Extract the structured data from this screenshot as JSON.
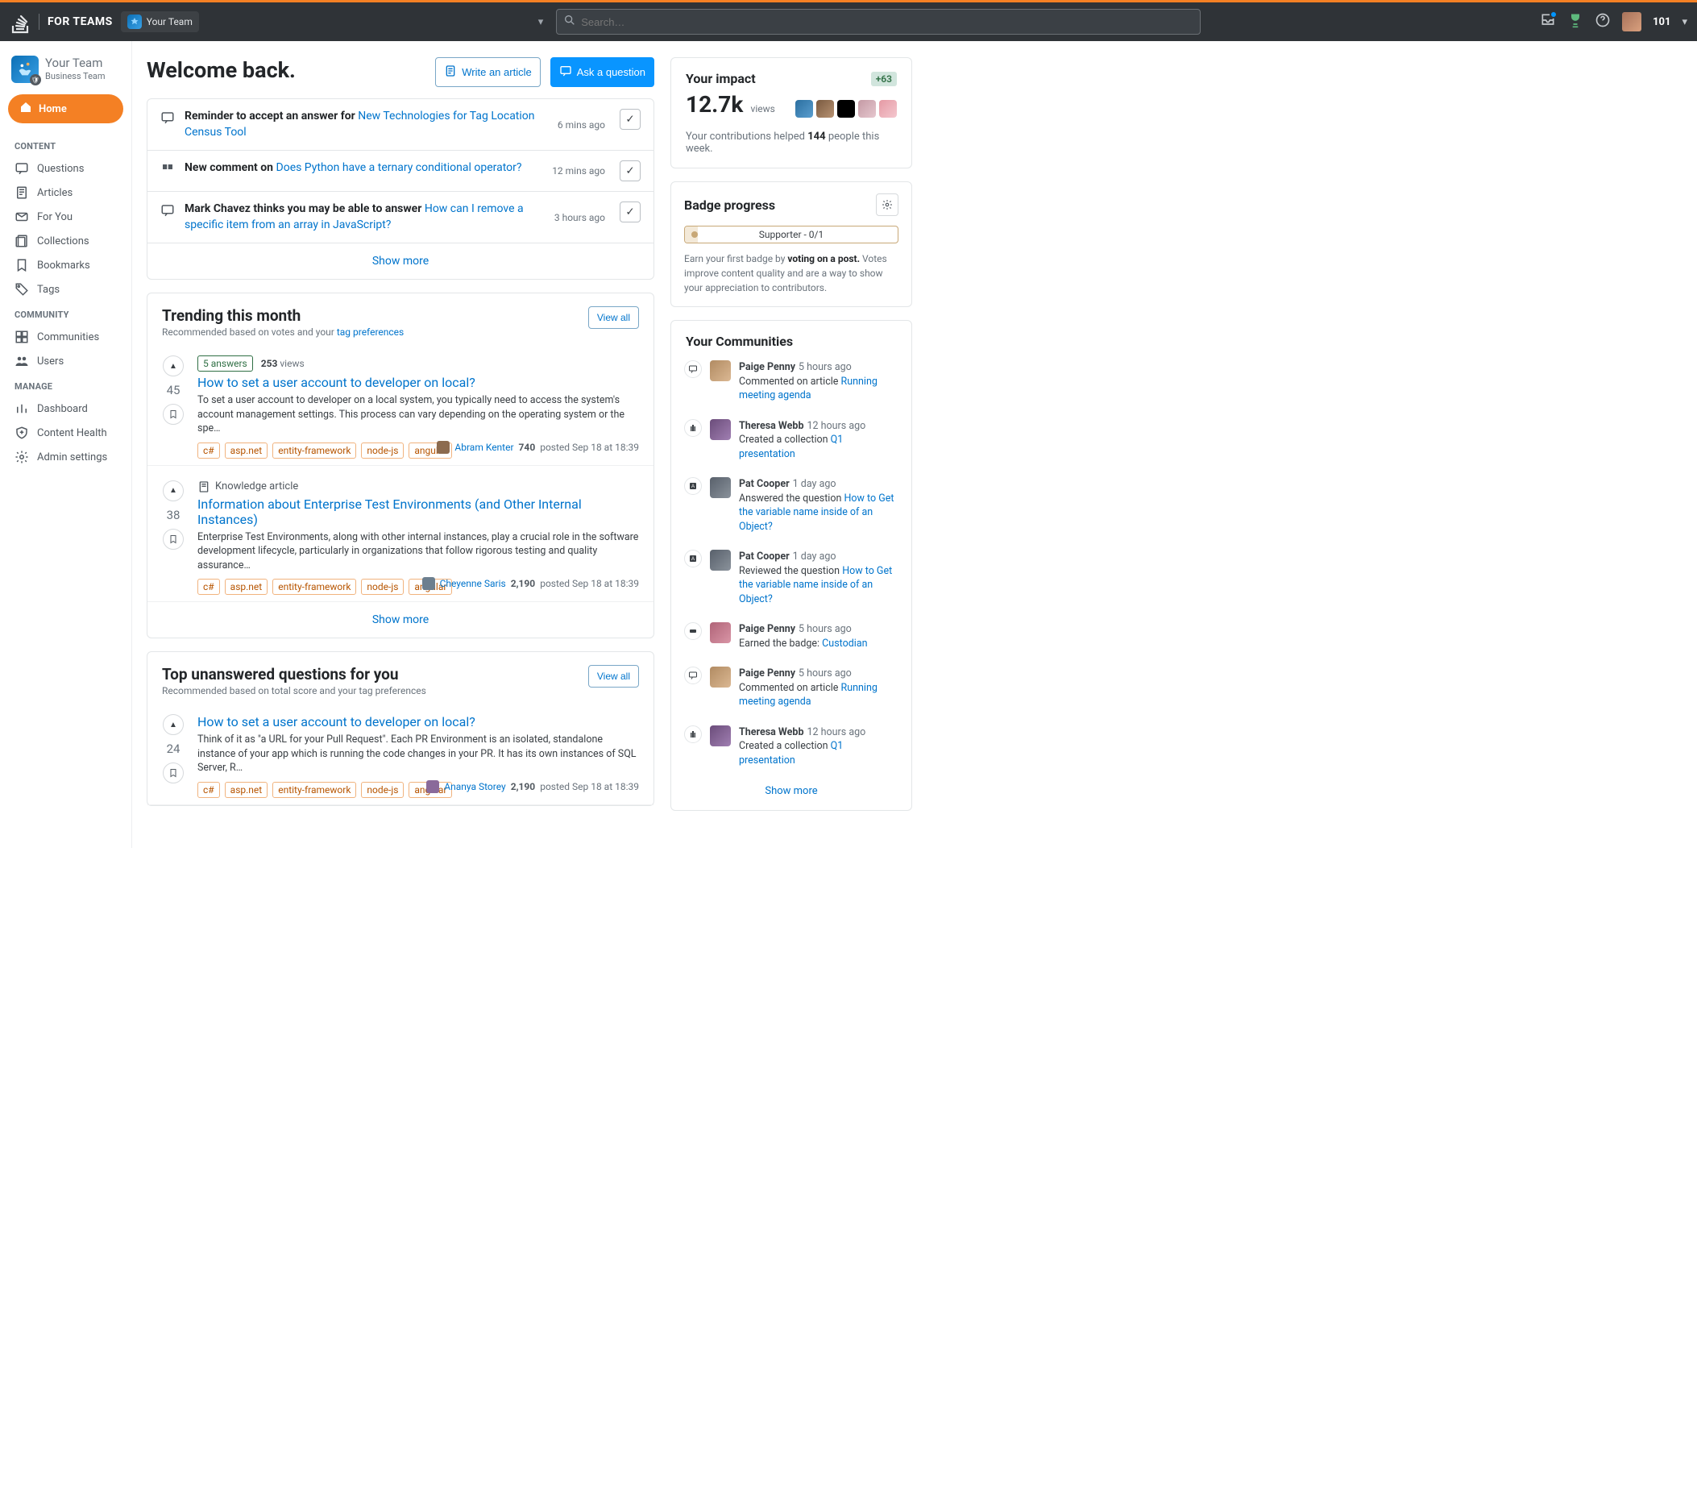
{
  "topbar": {
    "brand_text": "FOR TEAMS",
    "team_chip": "Your Team",
    "search_placeholder": "Search…",
    "rep": "101"
  },
  "sidebar": {
    "team_name": "Your Team",
    "team_plan": "Business Team",
    "home": "Home",
    "sections": {
      "content": "CONTENT",
      "community": "COMMUNITY",
      "manage": "MANAGE"
    },
    "content_items": [
      "Questions",
      "Articles",
      "For You",
      "Collections",
      "Bookmarks",
      "Tags"
    ],
    "community_items": [
      "Communities",
      "Users"
    ],
    "manage_items": [
      "Dashboard",
      "Content Health",
      "Admin settings"
    ]
  },
  "header": {
    "title": "Welcome back.",
    "write_article": "Write an article",
    "ask_question": "Ask a question"
  },
  "notifications": [
    {
      "prefix": "Reminder to accept an answer for ",
      "link": "New Technologies for Tag Location Census Tool",
      "time": "6 mins ago"
    },
    {
      "prefix": "New comment on ",
      "link": "Does Python have a ternary conditional operator?",
      "time": "12 mins ago"
    },
    {
      "prefix": "Mark Chavez thinks you may be able to answer ",
      "link": "How can I remove a specific item from an array in JavaScript?",
      "time": "3 hours ago"
    }
  ],
  "show_more": "Show more",
  "trending": {
    "title": "Trending this month",
    "subtitle_text": "Recommended based on votes and your ",
    "subtitle_link": "tag preferences",
    "view_all": "View all",
    "items": [
      {
        "votes": "45",
        "answer_chip": "5 answers",
        "views_num": "253",
        "views_label": "views",
        "title": "How to set a user account to developer on local?",
        "excerpt": "To set a user account to developer on a local system, you typically need to access the system's account management settings. This process can vary depending on the operating system or the spe…",
        "tags": [
          "c#",
          "asp.net",
          "entity-framework",
          "node-js",
          "angular"
        ],
        "user": "Abram Kenter",
        "rep": "740",
        "posted": "posted Sep 18 at 18:39"
      },
      {
        "votes": "38",
        "knowledge_label": "Knowledge article",
        "title": "Information about Enterprise Test Environments (and Other Internal Instances)",
        "excerpt": "Enterprise Test Environments, along with other internal instances, play a crucial role in the software development lifecycle, particularly in organizations that follow rigorous testing and quality assurance…",
        "tags": [
          "c#",
          "asp.net",
          "entity-framework",
          "node-js",
          "angular"
        ],
        "user": "Cheyenne Saris",
        "rep": "2,190",
        "posted": "posted Sep 18 at 18:39"
      }
    ]
  },
  "unanswered": {
    "title": "Top unanswered questions for you",
    "subtitle": "Recommended based on total score and your tag preferences",
    "view_all": "View all",
    "item": {
      "votes": "24",
      "title": "How to set a user account to developer on local?",
      "excerpt": "Think of it as \"a URL for your Pull Request\". Each PR Environment is an isolated, standalone instance of your app which is running the code changes in your PR. It has its own instances of SQL Server, R…",
      "tags": [
        "c#",
        "asp.net",
        "entity-framework",
        "node-js",
        "angular"
      ],
      "user": "Ananya Storey",
      "rep": "2,190",
      "posted": "posted Sep 18 at 18:39"
    }
  },
  "impact": {
    "title": "Your impact",
    "delta": "+63",
    "views_value": "12.7k",
    "views_label": "views",
    "line_pre": "Your contributions helped ",
    "line_num": "144",
    "line_post": " people this week."
  },
  "badge": {
    "title": "Badge progress",
    "bar_label": "Supporter - 0/1",
    "hint_pre": "Earn your first badge by ",
    "hint_strong": "voting on a post.",
    "hint_post": " Votes improve content quality and are a way to show your appreciation to contributors."
  },
  "communities": {
    "title": "Your Communities",
    "events": [
      {
        "icon": "comment",
        "avatar": "evA",
        "name": "Paige Penny",
        "time": "5 hours ago",
        "action": "Commented on article ",
        "link": "Running meeting agenda"
      },
      {
        "icon": "collection",
        "avatar": "evB",
        "name": "Theresa Webb",
        "time": "12 hours ago",
        "action": "Created a collection ",
        "link": "Q1 presentation"
      },
      {
        "icon": "answer",
        "avatar": "evC",
        "name": "Pat Cooper",
        "time": "1 day ago",
        "action": "Answered the question ",
        "link": "How to Get the variable name inside of an Object?"
      },
      {
        "icon": "answer",
        "avatar": "evC",
        "name": "Pat Cooper",
        "time": "1 day ago",
        "action": "Reviewed the question ",
        "link": "How to Get the variable name inside of an Object?"
      },
      {
        "icon": "badge",
        "avatar": "evD",
        "name": "Paige Penny",
        "time": "5 hours ago",
        "action": "Earned the badge: ",
        "link": "Custodian"
      },
      {
        "icon": "comment",
        "avatar": "evA",
        "name": "Paige Penny",
        "time": "5 hours ago",
        "action": "Commented on article ",
        "link": "Running meeting agenda"
      },
      {
        "icon": "collection",
        "avatar": "evB",
        "name": "Theresa Webb",
        "time": "12 hours ago",
        "action": "Created a collection ",
        "link": "Q1 presentation"
      }
    ],
    "show_more": "Show more"
  }
}
